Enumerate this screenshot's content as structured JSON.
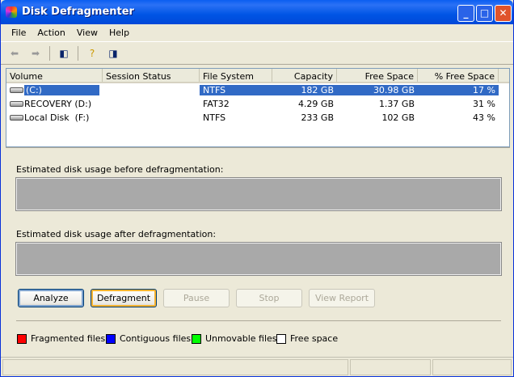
{
  "window": {
    "title": "Disk Defragmenter"
  },
  "menu": [
    "File",
    "Action",
    "View",
    "Help"
  ],
  "table": {
    "headers": [
      "Volume",
      "Session Status",
      "File System",
      "Capacity",
      "Free Space",
      "% Free Space"
    ],
    "rows": [
      [
        "(C:)",
        "",
        "NTFS",
        "182 GB",
        "30.98 GB",
        "17 %"
      ],
      [
        "RECOVERY (D:)",
        "",
        "FAT32",
        "4.29 GB",
        "1.37 GB",
        "31 %"
      ],
      [
        "Local Disk  (F:)",
        "",
        "NTFS",
        "233 GB",
        "102 GB",
        "43 %"
      ]
    ]
  },
  "labels": {
    "before": "Estimated disk usage before defragmentation:",
    "after": "Estimated disk usage after defragmentation:"
  },
  "buttons": {
    "analyze": "Analyze",
    "defragment": "Defragment",
    "pause": "Pause",
    "stop": "Stop",
    "report": "View Report"
  },
  "legend": [
    {
      "label": "Fragmented files",
      "color": "#ff0000"
    },
    {
      "label": "Contiguous files",
      "color": "#0000ff"
    },
    {
      "label": "Unmovable files",
      "color": "#00ff00"
    },
    {
      "label": "Free space",
      "color": "#ffffff"
    }
  ]
}
